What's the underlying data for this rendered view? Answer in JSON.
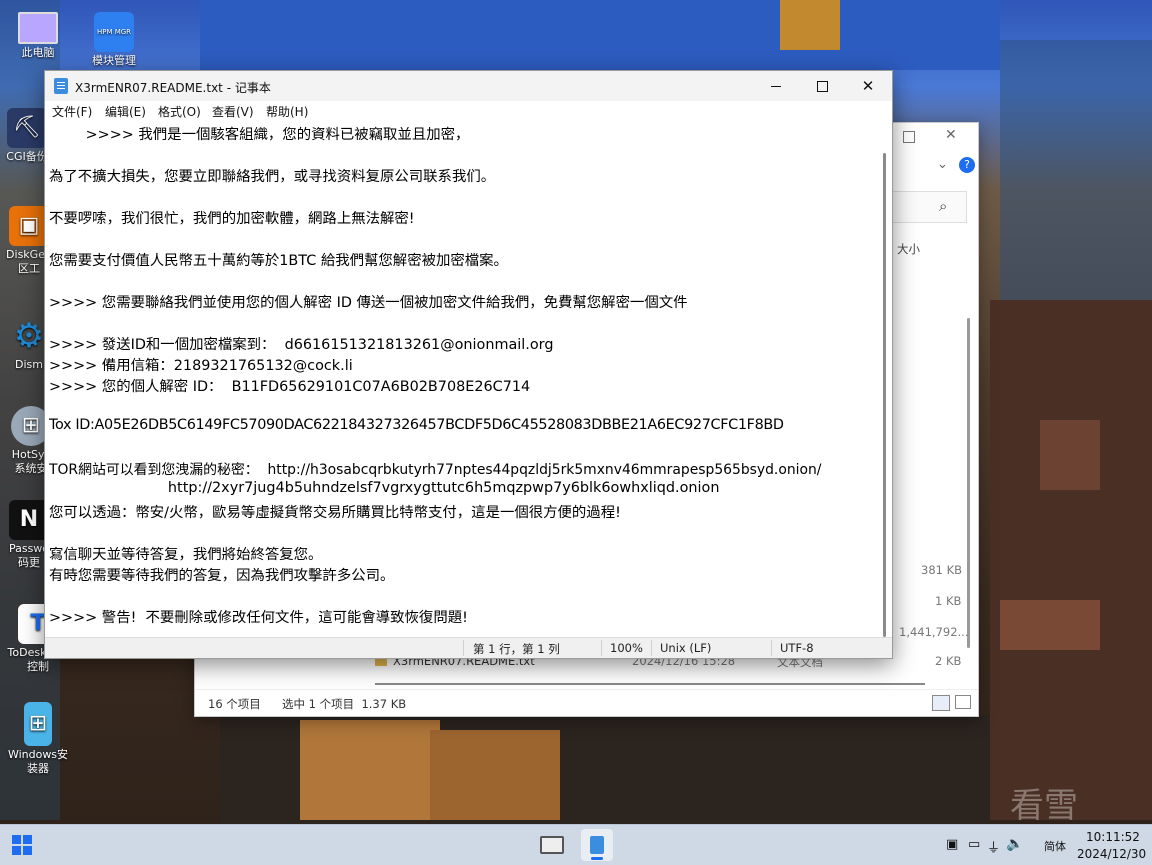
{
  "desktop": {
    "icons": [
      {
        "label": "此电脑",
        "icon": "computer-icon",
        "color": "#b9a7ff"
      },
      {
        "label": "模块管理",
        "icon": "grid-app-icon",
        "color": "#2e7ff0",
        "badge": "HPM MGR"
      },
      {
        "label": "CGI备份",
        "icon": "cgi-backup-icon",
        "color": "#2a3a66"
      },
      {
        "label": "DiskGen\n区工",
        "icon": "diskgenius-icon",
        "color": "#e8710a"
      },
      {
        "label": "Dism",
        "icon": "gear-icon",
        "color": "#1e8ad6"
      },
      {
        "label": "HotSys\n系统安",
        "icon": "setup-icon",
        "color": "#9aa9b8"
      },
      {
        "label": "Passwo\n码更",
        "icon": "password-tool-icon",
        "color": "#111111"
      },
      {
        "label": "ToDesk远程\n控制",
        "icon": "todesk-icon",
        "color": "#1d6cf2"
      },
      {
        "label": "Windows安\n装器",
        "icon": "windows-installer-icon",
        "color": "#4ab3e8"
      }
    ]
  },
  "explorer": {
    "size_header": "大小",
    "rows": [
      {
        "size": "381 KB"
      },
      {
        "size": "1 KB"
      },
      {
        "size": "1,441,792..."
      },
      {
        "name": "X3rmENR07.README.txt",
        "date": "2024/12/16 15:28",
        "type": "文本文档",
        "size": "2 KB"
      }
    ],
    "status": {
      "count": "16 个项目",
      "selection": "选中 1 个项目  1.37 KB"
    }
  },
  "notepad": {
    "title": "X3rmENR07.README.txt - 记事本",
    "menu": [
      "文件(F)",
      "编辑(E)",
      "格式(O)",
      "查看(V)",
      "帮助(H)"
    ],
    "lines": [
      "        >>>> 我們是一個駭客組織，您的資料已被竊取並且加密，",
      "",
      "為了不擴大損失，您要立即聯絡我們，或寻找资料复原公司联系我们。",
      "",
      "不要啰嗦，我们很忙，我們的加密軟體，網路上無法解密!",
      "",
      "您需要支付價值人民幣五十萬約等於1BTC 給我們幫您解密被加密檔案。",
      "",
      ">>>> 您需要聯絡我們並使用您的個人解密 ID 傳送一個被加密文件給我們，免費幫您解密一個文件",
      "",
      ">>>> 發送ID和一個加密檔案到：  d6616151321813261@onionmail.org",
      ">>>> 備用信箱：2189321765132@cock.li",
      ">>>> 您的個人解密 ID：  B11FD65629101C07A6B02B708E26C714",
      "",
      "Tox ID:A05E26DB5C6149FC57090DAC622184327326457BCDF5D6C45528083DBBE21A6EC927CFC1F8BD",
      "",
      "TOR網站可以看到您洩漏的秘密：  http://h3osabcqrbkutyrh77nptes44pqzldj5rk5mxnv46mmrapesp565bsyd.onion/",
      "                          http://2xyr7jug4b5uhndzelsf7vgrxygttutc6h5mqzpwp7y6blk6owhxliqd.onion",
      "您可以透過：幣安/火幣，歐易等虛擬貨幣交易所購買比特幣支付，這是一個很方便的過程!",
      "",
      "寫信聊天並等待答复，我們將始終答复您。",
      "有時您需要等待我們的答复，因為我們攻擊許多公司。",
      "",
      ">>>> 警告!  不要刪除或修改任何文件，這可能會導致恢復問題!"
    ],
    "status": {
      "position": "第 1 行，第 1 列",
      "zoom": "100%",
      "line_ending": "Unix (LF)",
      "encoding": "UTF-8"
    }
  },
  "taskbar": {
    "time": "10:11:52",
    "date": "2024/12/30",
    "ime": "简体",
    "accent": "#1d6cf2"
  },
  "watermark": "看雪"
}
